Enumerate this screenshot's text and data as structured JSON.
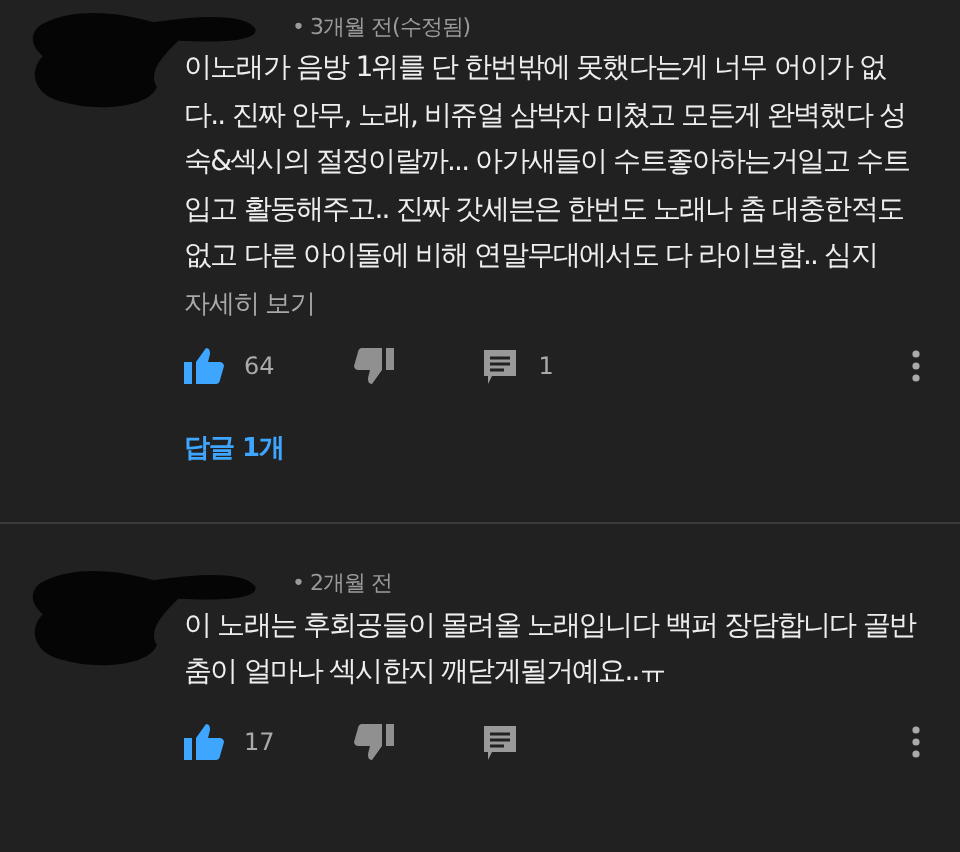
{
  "comments": [
    {
      "time": "• 3개월 전(수정됨)",
      "text": "이노래가 음방 1위를 단 한번밖에 못했다는게 너무 어이가 없다.. 진짜 안무, 노래, 비쥬얼 삼박자 미쳤고 모든게 완벽했다 성숙&섹시의 절정이랄까... 아가새들이 수트좋아하는거일고 수트입고 활동해주고.. 진짜 갓세븐은 한번도 노래나 춤 대충한적도없고 다른 아이돌에 비해 연말무대에서도 다 라이브함.. 심지",
      "more": "자세히 보기",
      "liked": true,
      "likes": "64",
      "reply_count": "1",
      "replies_link": "답글 1개"
    },
    {
      "time": "• 2개월 전",
      "text": "이 노래는 후회공들이 몰려올 노래입니다 백퍼 장담합니다 골반춤이 얼마나 섹시한지 깨닫게될거예요..ㅠ",
      "liked": true,
      "likes": "17"
    }
  ]
}
